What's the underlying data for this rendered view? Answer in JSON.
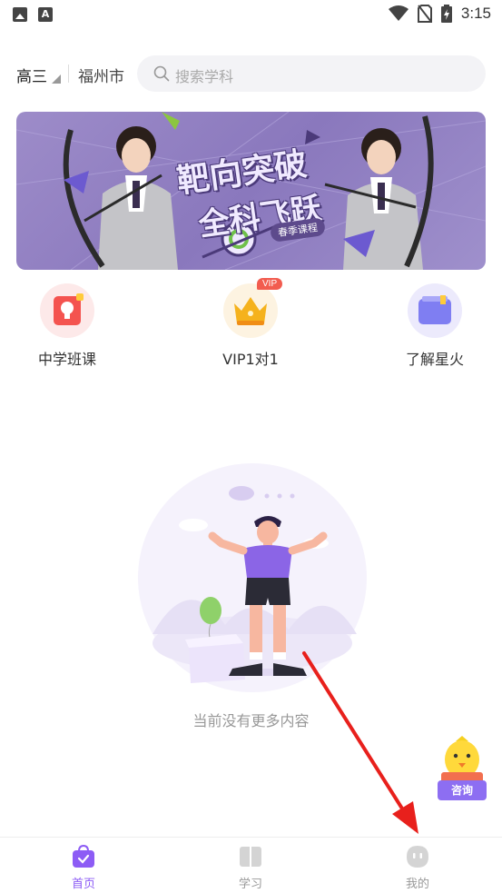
{
  "status_bar": {
    "time": "3:15",
    "left_icons": [
      "image-icon",
      "a-icon"
    ],
    "right_icons": [
      "wifi-icon",
      "no-sim-icon",
      "battery-icon"
    ]
  },
  "header": {
    "grade": "高三",
    "city": "福州市",
    "search_placeholder": "搜索学科"
  },
  "banner": {
    "title_line1": "靶向突破",
    "title_line2": "全科飞跃",
    "tag": "春季课程"
  },
  "entries": [
    {
      "label": "中学班课",
      "icon": "lightbulb-icon",
      "color": "#f4534f"
    },
    {
      "label": "VIP1对1",
      "icon": "crown-icon",
      "color": "#f5b21d",
      "badge": "VIP"
    },
    {
      "label": "了解星火",
      "icon": "book-icon",
      "color": "#7f7ef2"
    }
  ],
  "empty_state": {
    "text": "当前没有更多内容"
  },
  "consult": {
    "label": "咨询"
  },
  "bottom_nav": {
    "active_color": "#8d5cf5",
    "inactive_color": "#999999",
    "items": [
      {
        "label": "首页",
        "icon": "home-bag-icon",
        "active": true
      },
      {
        "label": "学习",
        "icon": "study-book-icon",
        "active": false
      },
      {
        "label": "我的",
        "icon": "profile-face-icon",
        "active": false
      }
    ]
  }
}
